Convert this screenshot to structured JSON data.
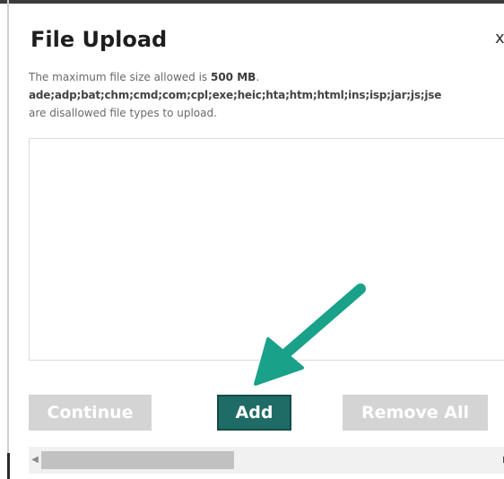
{
  "dialog": {
    "title": "File Upload",
    "close_glyph": "x",
    "size_prefix": "The maximum file size allowed is ",
    "size_value": "500 MB",
    "size_suffix": ".",
    "disallowed_types": "ade;adp;bat;chm;cmd;com;cpl;exe;heic;hta;htm;html;ins;isp;jar;js;jse",
    "disallowed_suffix": "are disallowed file types to upload."
  },
  "buttons": {
    "continue_label": "Continue",
    "add_label": "Add",
    "remove_all_label": "Remove All"
  },
  "scrollbar": {
    "left_icon": "scroll-left-arrow",
    "right_icon": "scroll-right-arrow"
  },
  "colors": {
    "add_button": "#1f6b66",
    "disabled_button": "#d4d4d4",
    "annotation_arrow": "#1aa189"
  },
  "annotation": {
    "icon": "arrow-pointing-to-add-button"
  }
}
